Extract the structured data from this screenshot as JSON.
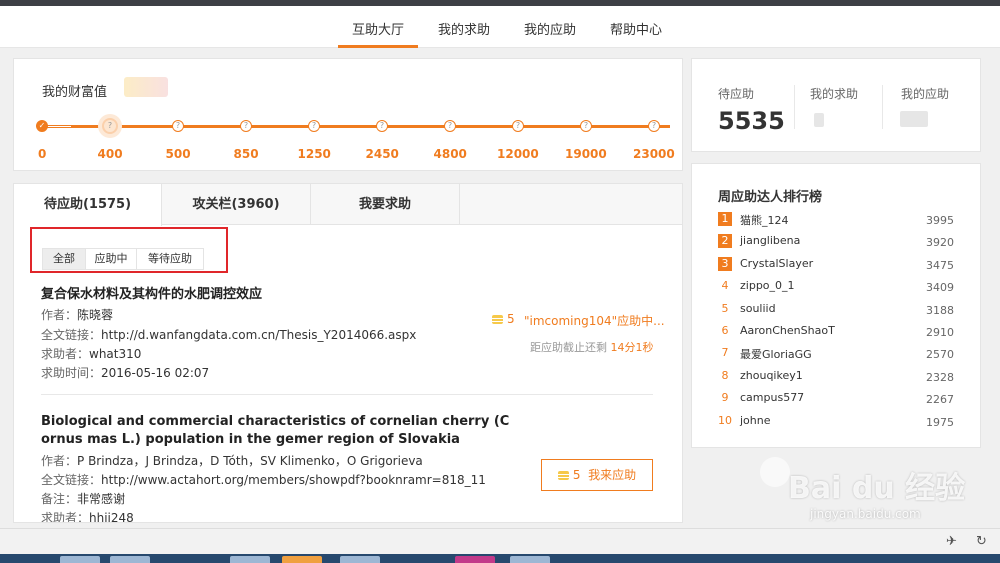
{
  "nav": {
    "tabs": [
      {
        "label": "互助大厅",
        "active": true
      },
      {
        "label": "我的求助",
        "active": false
      },
      {
        "label": "我的应助",
        "active": false
      },
      {
        "label": "帮助中心",
        "active": false
      }
    ]
  },
  "wealth": {
    "title": "我的财富值",
    "levels": [
      "0",
      "400",
      "500",
      "850",
      "1250",
      "2450",
      "4800",
      "12000",
      "19000",
      "23000"
    ],
    "node_mark": "?",
    "current_level_index": 1
  },
  "stats": {
    "pending_label": "待应助",
    "pending_value": "5535",
    "my_requests_label": "我的求助",
    "my_helps_label": "我的应助"
  },
  "list": {
    "tabs": [
      "待应助(1575)",
      "攻关栏(3960)",
      "我要求助"
    ],
    "filters": [
      "全部",
      "应助中",
      "等待应助"
    ],
    "items": [
      {
        "title": "复合保水材料及其构件的水肥调控效应",
        "author_label": "作者：",
        "author": "陈晓蓉",
        "link_label": "全文链接：",
        "link": "http://d.wanfangdata.com.cn/Thesis_Y2014066.aspx",
        "requester_label": "求助者：",
        "requester": "what310",
        "time_label": "求助时间：",
        "time": "2016-05-16 02:07",
        "reward": "5",
        "status": "\"imcoming104\"应助中...",
        "deadline_prefix": "距应助截止还剩",
        "deadline_time": "14分1秒"
      },
      {
        "title_line1": "Biological and commercial characteristics of cornelian cherry (C",
        "title_line2": "ornus mas L.) population in the gemer region of Slovakia",
        "author_label": "作者：",
        "author": "P Brindza，J Brindza，D Tóth，SV Klimenko，O Grigorieva",
        "link_label": "全文链接：",
        "link": "http://www.actahort.org/members/showpdf?booknramr=818_11",
        "note_label": "备注：",
        "note": "非常感谢",
        "requester_label": "求助者：",
        "requester": "hhjj248",
        "reward": "5",
        "button": "我来应助"
      }
    ]
  },
  "ranking": {
    "title": "周应助达人排行榜",
    "rows": [
      {
        "rank": "1",
        "name": "猫熊_124",
        "score": "3995"
      },
      {
        "rank": "2",
        "name": "jianglibena",
        "score": "3920"
      },
      {
        "rank": "3",
        "name": "CrystalSlayer",
        "score": "3475"
      },
      {
        "rank": "4",
        "name": "zippo_0_1",
        "score": "3409"
      },
      {
        "rank": "5",
        "name": "souliid",
        "score": "3188"
      },
      {
        "rank": "6",
        "name": "AaronChenShaoT",
        "score": "2910"
      },
      {
        "rank": "7",
        "name": "最爱GloriaGG",
        "score": "2570"
      },
      {
        "rank": "8",
        "name": "zhouqikey1",
        "score": "2328"
      },
      {
        "rank": "9",
        "name": "campus577",
        "score": "2267"
      },
      {
        "rank": "10",
        "name": "johne",
        "score": "1975"
      }
    ]
  },
  "watermark": {
    "text": "Bai du 经验",
    "sub": "jingyan.baidu.com"
  },
  "colors": {
    "accent": "#f07c1f",
    "highlight_box": "#e0262a"
  }
}
